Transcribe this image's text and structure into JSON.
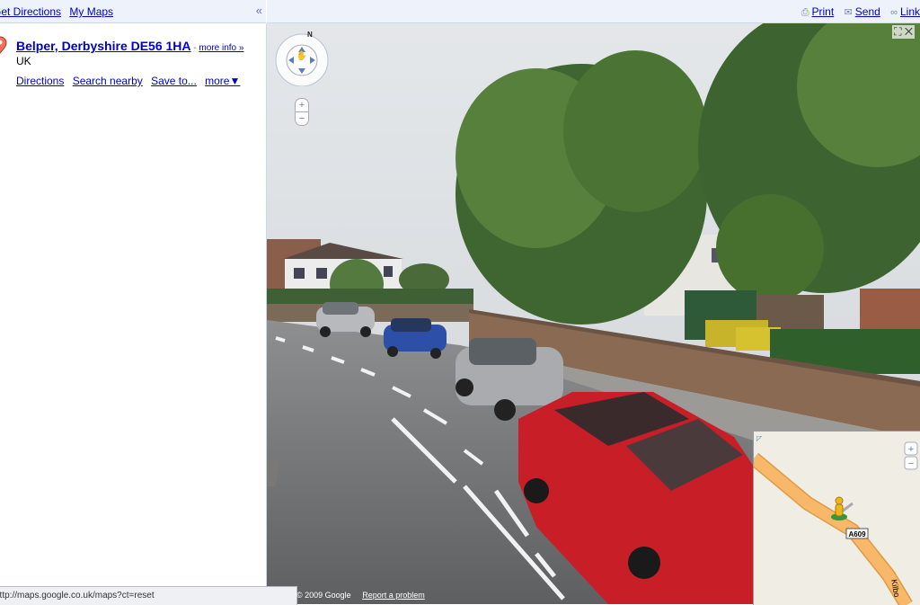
{
  "header": {
    "get_directions": "Get Directions",
    "my_maps": "My Maps",
    "collapse": "«"
  },
  "result": {
    "title": "Belper, Derbyshire DE56 1HA",
    "separator": " - ",
    "more_info": "more info »",
    "country": "UK",
    "actions": {
      "directions": "Directions",
      "search_nearby": "Search nearby",
      "save_to": "Save to...",
      "more": "more▼"
    }
  },
  "top_actions": {
    "print": "Print",
    "send": "Send",
    "link": "Link"
  },
  "streetview": {
    "compass_label": "N",
    "zoom_in": "+",
    "zoom_out": "−",
    "expand": "⛶ ✕"
  },
  "minimap": {
    "road_a609": "A609",
    "road_partial": "Kilbo",
    "zoom_in": "+",
    "zoom_out": "−"
  },
  "status_url": "http://maps.google.co.uk/maps?ct=reset",
  "footer": {
    "copyright": "© 2009 Google",
    "report": "Report a problem"
  },
  "colors": {
    "link": "#0000cc",
    "panel_bg": "#eef2fb",
    "road": "#f6b15a"
  }
}
